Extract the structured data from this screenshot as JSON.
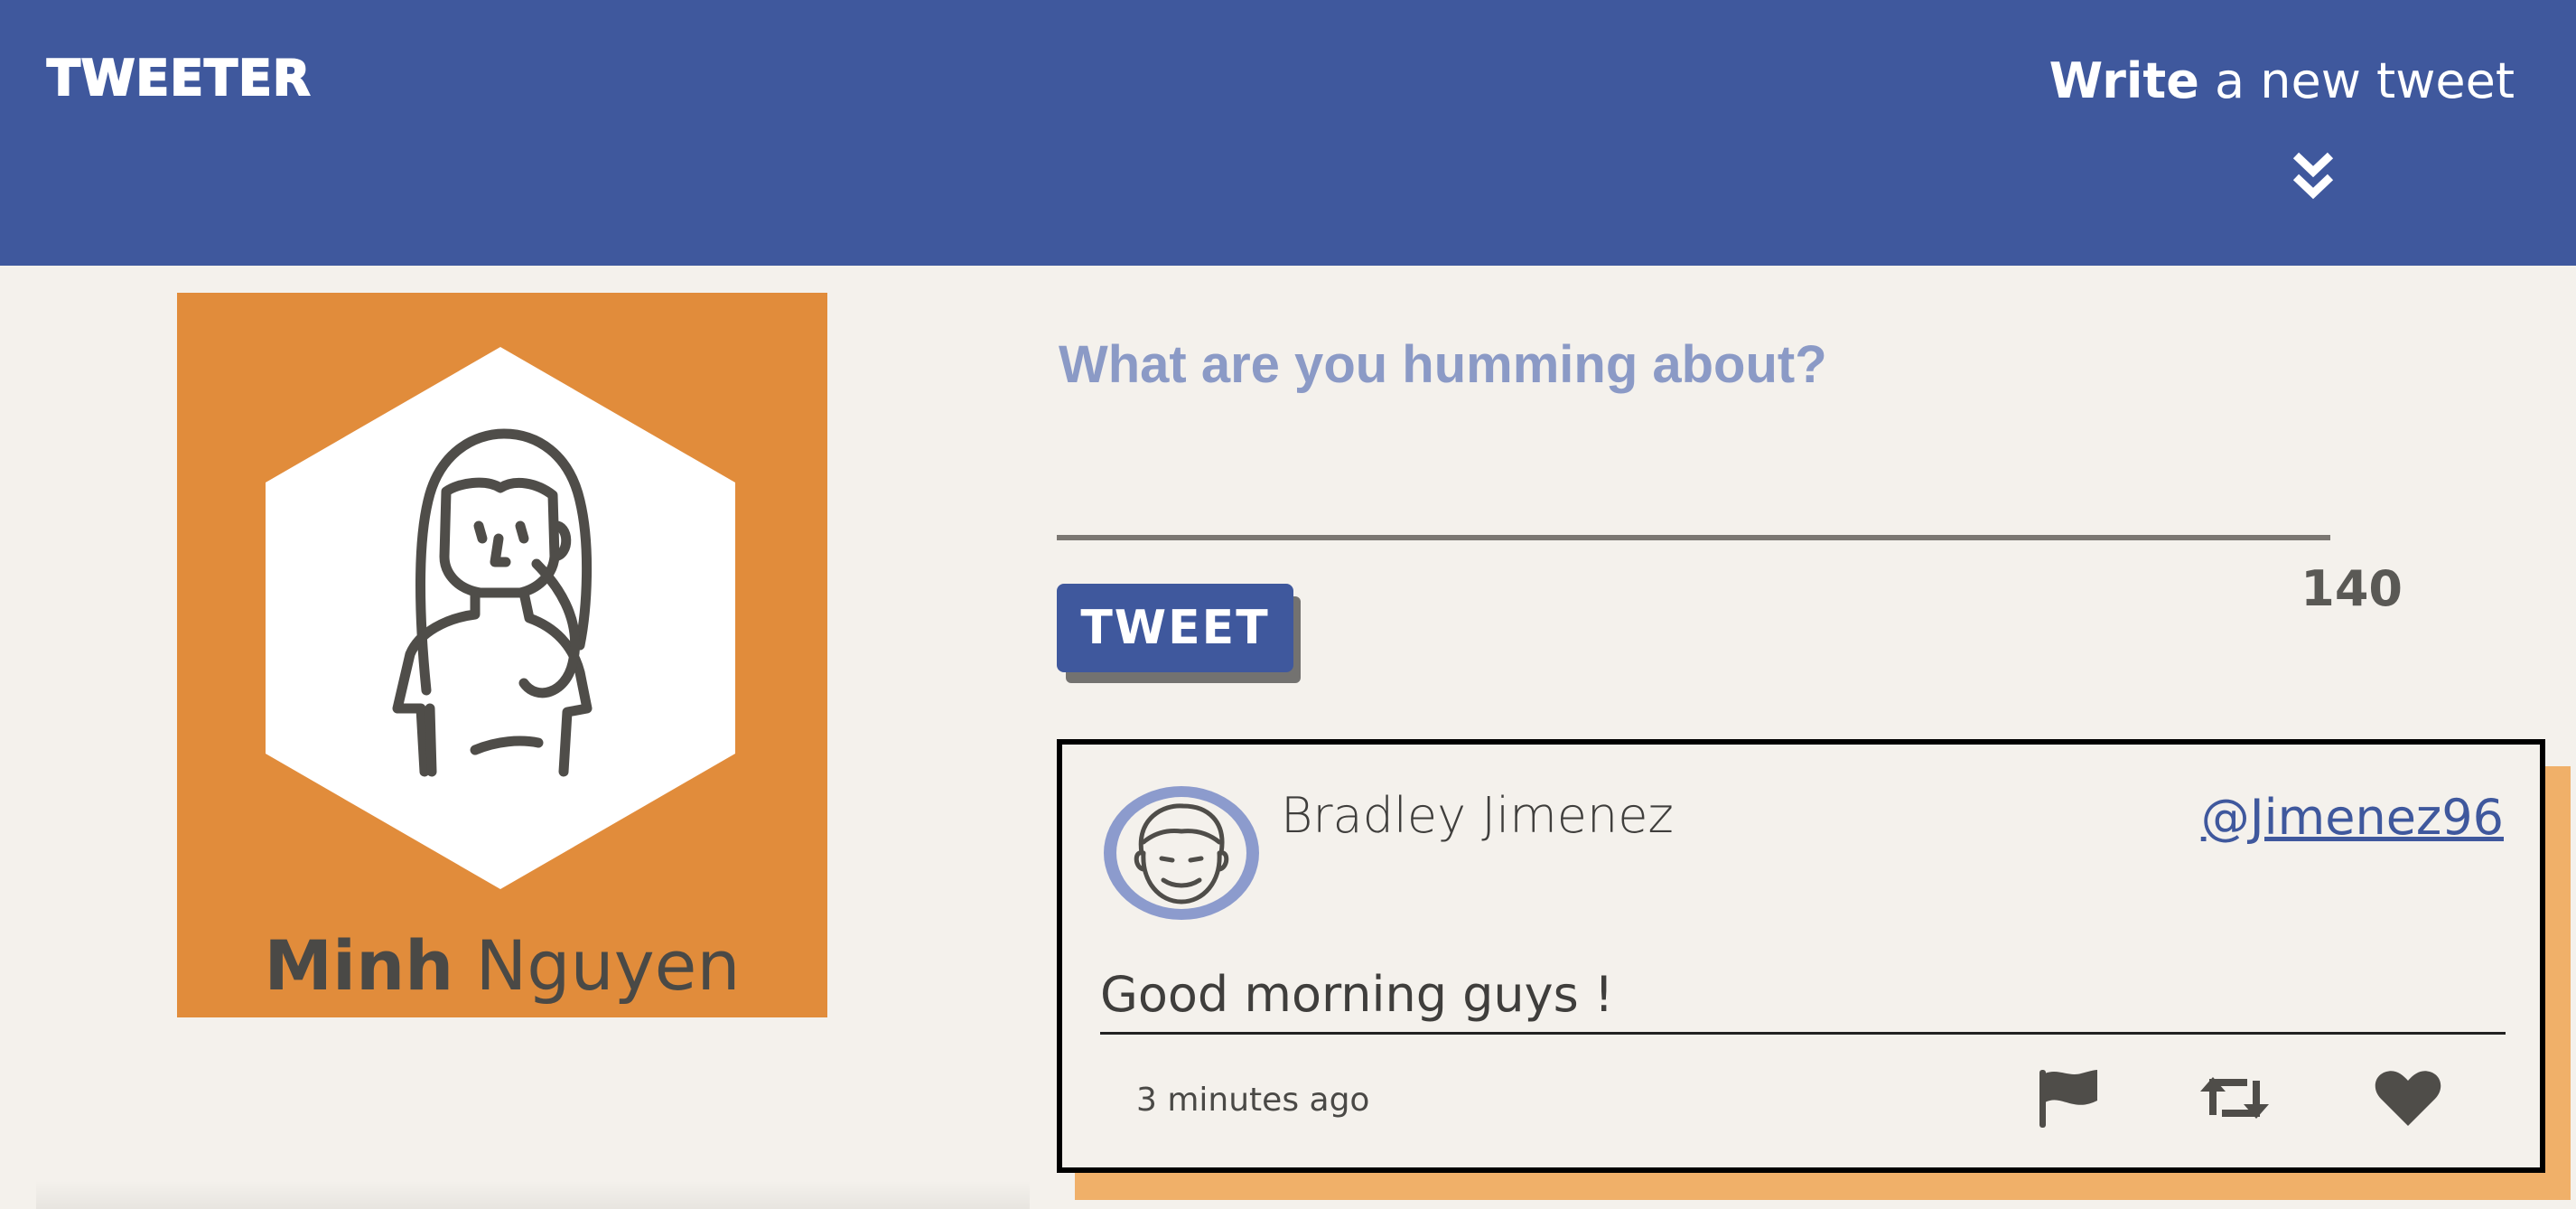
{
  "header": {
    "brand": "TWEETER",
    "compose_toggle_strong": "Write",
    "compose_toggle_rest": " a new tweet",
    "chevron_icon": "double-chevron-down-icon"
  },
  "profile": {
    "first_name": "Minh",
    "last_name": " Nguyen",
    "avatar_icon": "woman-avatar-icon",
    "card_color": "#e18c3b"
  },
  "composer": {
    "placeholder": "What are you humming about?",
    "value": "",
    "tweet_button_label": "TWEET",
    "char_counter": "140"
  },
  "tweets": [
    {
      "author_name": "Bradley Jimenez",
      "handle": "@Jimenez96",
      "avatar_icon": "man-avatar-icon",
      "content": "Good morning guys !",
      "timestamp": "3 minutes ago",
      "actions": [
        "flag-icon",
        "retweet-icon",
        "heart-icon"
      ]
    }
  ],
  "colors": {
    "brand_blue": "#3f589d",
    "background": "#f4f1ec",
    "accent_orange": "#e18c3b",
    "tweet_shadow": "#f0b069",
    "placeholder_color": "#8b9ac6"
  }
}
